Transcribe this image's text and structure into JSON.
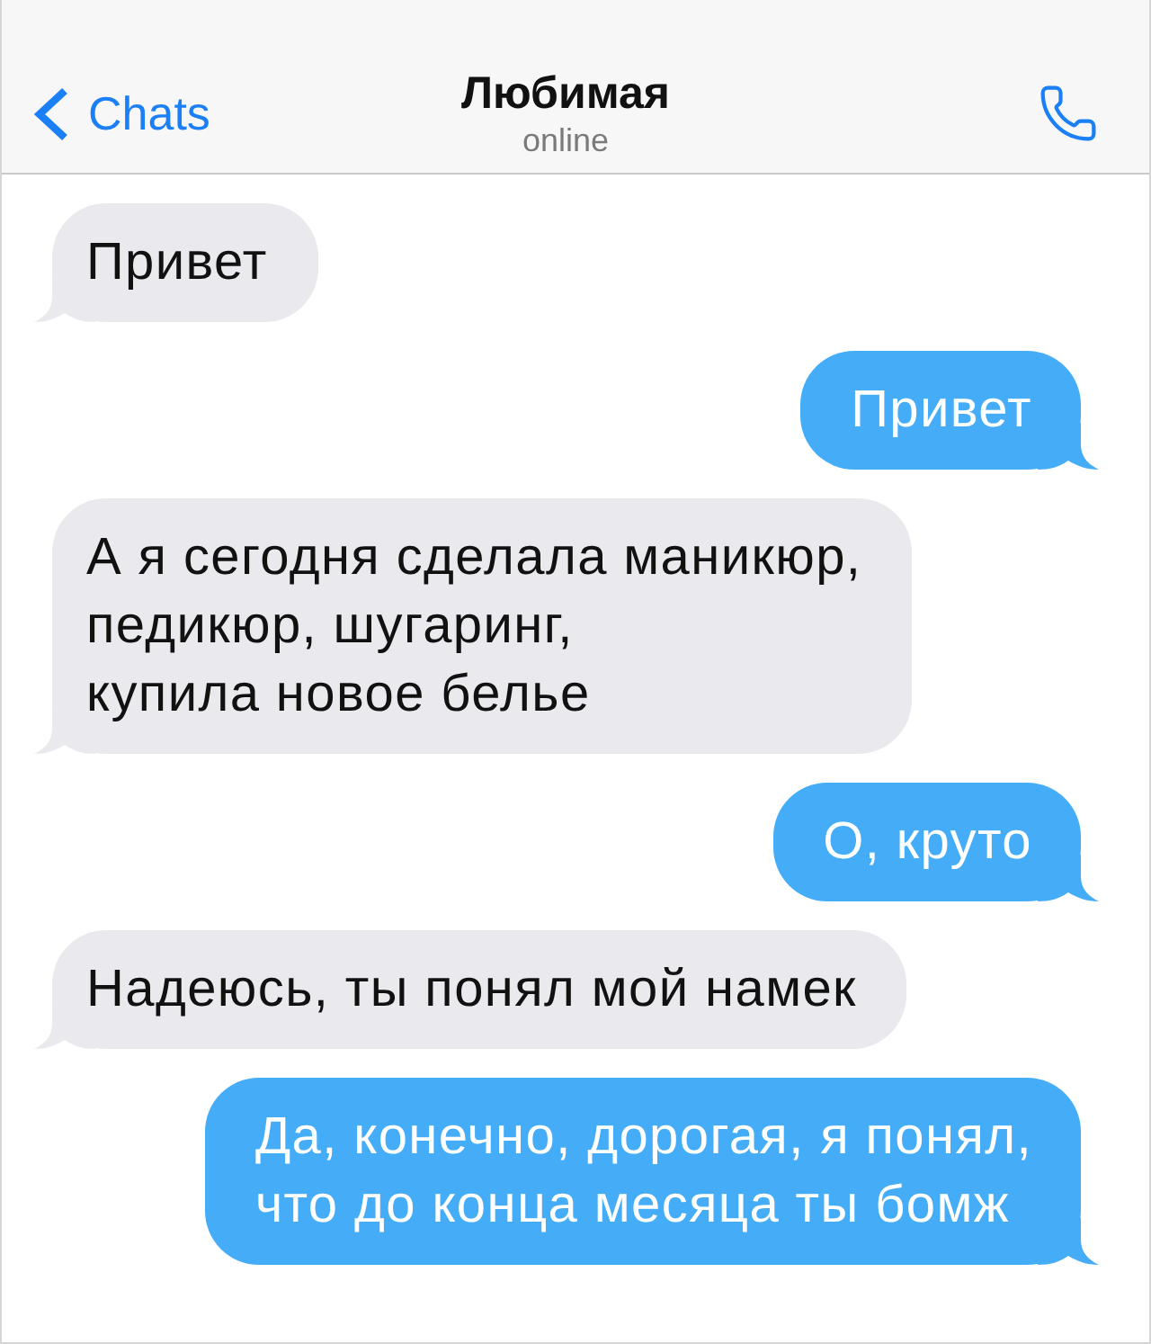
{
  "header": {
    "back_label": "Chats",
    "title": "Любимая",
    "status": "online"
  },
  "messages": [
    {
      "kind": "received",
      "text": "Привет"
    },
    {
      "kind": "sent",
      "text": "Привет"
    },
    {
      "kind": "received",
      "text": "А я сегодня сделала маникюр,\nпедикюр, шугаринг,\nкупила новое белье"
    },
    {
      "kind": "sent",
      "text": "О, круто"
    },
    {
      "kind": "received",
      "text": "Надеюсь, ты понял мой намек"
    },
    {
      "kind": "sent",
      "text": "Да, конечно, дорогая, я понял,\nчто до конца месяца ты бомж"
    }
  ]
}
